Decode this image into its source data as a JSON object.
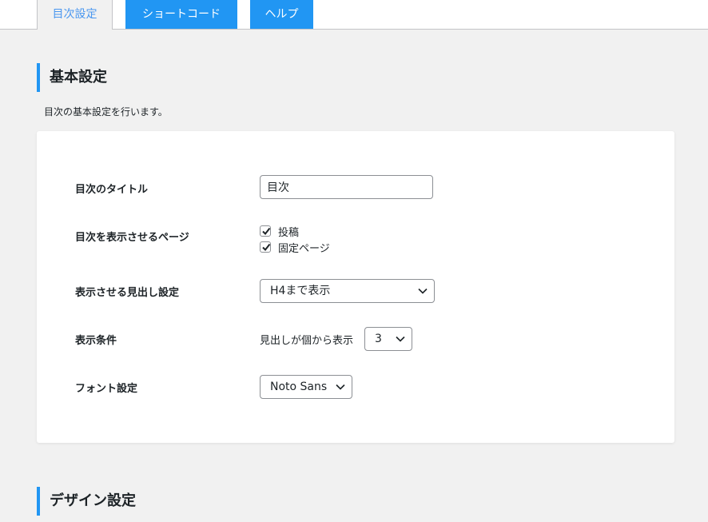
{
  "tabs": [
    {
      "label": "目次設定",
      "active": true
    },
    {
      "label": "ショートコード",
      "active": false
    },
    {
      "label": "ヘルプ",
      "active": false
    }
  ],
  "basic": {
    "heading": "基本設定",
    "description": "目次の基本設定を行います。",
    "title_label": "目次のタイトル",
    "title_value": "目次",
    "pages_label": "目次を表示させるページ",
    "pages": [
      {
        "label": "投稿",
        "checked": true
      },
      {
        "label": "固定ページ",
        "checked": true
      }
    ],
    "heading_setting_label": "表示させる見出し設定",
    "heading_setting_value": "H4まで表示",
    "condition_label": "表示条件",
    "condition_prefix": "見出しが個から表示",
    "condition_value": "3",
    "font_label": "フォント設定",
    "font_value": "Noto Sans"
  },
  "design": {
    "heading": "デザイン設定"
  },
  "colors": {
    "accent": "#2196f3",
    "active_tab_text": "#4a97f0",
    "background": "#f1f1f1",
    "card": "#ffffff"
  },
  "icons": {
    "checkbox": "check-icon",
    "select": "chevron-down-icon"
  }
}
